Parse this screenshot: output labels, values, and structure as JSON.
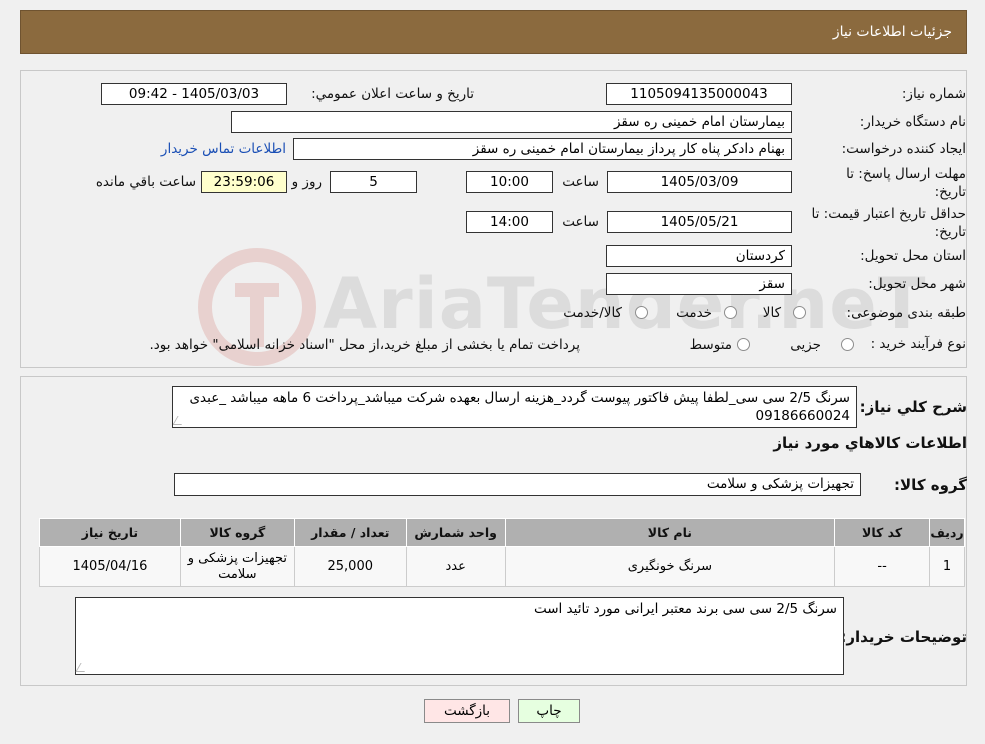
{
  "header": {
    "title": "جزئیات اطلاعات نیاز"
  },
  "watermark": {
    "text": "AriaTender.neT"
  },
  "form": {
    "need_number_label": "شماره نیاز:",
    "need_number": "1105094135000043",
    "announce_label": "تاریخ و ساعت اعلان عمومي:",
    "announce_value": "1405/03/03 - 09:42",
    "buyer_org_label": "نام دستگاه خریدار:",
    "buyer_org": "بیمارستان امام خمینی  ره  سقز",
    "creator_label": "ایجاد کننده درخواست:",
    "creator": "بهنام دادکر پناه کار پرداز بیمارستان امام خمینی  ره  سقز",
    "contact_link": "اطلاعات تماس خریدار",
    "deadline_label_1": "مهلت ارسال پاسخ: تا",
    "deadline_label_2": "تاریخ:",
    "deadline_date": "1405/03/09",
    "time_label": "ساعت",
    "deadline_time": "10:00",
    "days_value": "5",
    "days_label": "روز و",
    "remaining_time": "23:59:06",
    "remaining_label": "ساعت باقي مانده",
    "validity_label_1": "حداقل تاریخ اعتبار قیمت: تا",
    "validity_label_2": "تاریخ:",
    "validity_date": "1405/05/21",
    "validity_time": "14:00",
    "province_label": "استان محل تحویل:",
    "province": "کردستان",
    "city_label": "شهر محل تحویل:",
    "city": "سقز",
    "category_label": "طبقه بندی موضوعی:",
    "category_options": [
      "کالا",
      "خدمت",
      "کالا/خدمت"
    ],
    "process_label": "نوع فرآیند خرید :",
    "process_options": [
      "جزیی",
      "متوسط"
    ],
    "process_note": "پرداخت تمام یا بخشی از مبلغ خرید،از محل \"اسناد خزانه اسلامی\" خواهد بود."
  },
  "details": {
    "summary_label": "شرح کلي نياز:",
    "summary": "سرنگ 2/5 سی سی_لطفا پیش فاکتور پیوست گردد_هزینه ارسال بعهده شرکت میباشد_پرداخت 6 ماهه میباشد _عبدی 09186660024",
    "goods_info_title": "اطلاعات کالاهاي مورد نياز",
    "group_label": "گروه کالا:",
    "group_value": "تجهیزات پزشکی و سلامت"
  },
  "table": {
    "headers": [
      "رديف",
      "کد کالا",
      "نام کالا",
      "واحد شمارش",
      "تعداد / مقدار",
      "گروه کالا",
      "تاریخ نیاز"
    ],
    "rows": [
      [
        "1",
        "--",
        "سرنگ خونگیری",
        "عدد",
        "25,000",
        "تجهیزات پزشکی و سلامت",
        "1405/04/16"
      ]
    ]
  },
  "buyer_notes": {
    "label": "توضیحات خریدار:",
    "text": "سرنگ 2/5 سی سی  برند معتبر ایرانی مورد تائید است"
  },
  "buttons": {
    "print": "چاپ",
    "back": "بازگشت"
  },
  "colors": {
    "header_bg": "#8b6a3e",
    "print_bg": "#e6ffe0",
    "back_bg": "#ffe6e6"
  }
}
